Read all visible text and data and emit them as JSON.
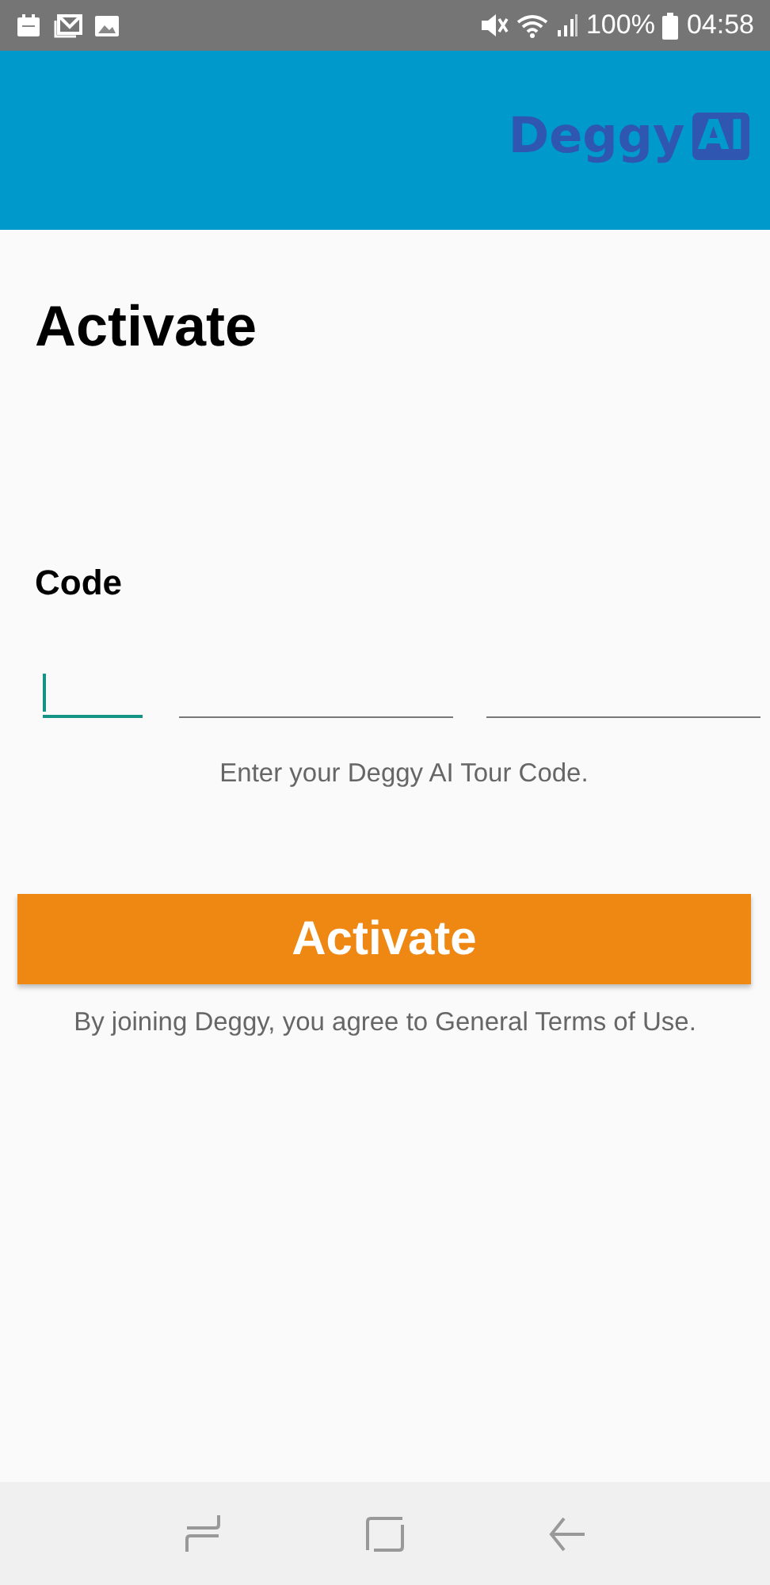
{
  "status_bar": {
    "battery": "100%",
    "time": "04:58"
  },
  "header": {
    "logo": {
      "name": "Deggy",
      "badge": "AI"
    }
  },
  "title": "Activate",
  "code": {
    "label": "Code",
    "fields": [
      {
        "focused": true
      },
      {
        "focused": false
      },
      {
        "focused": false
      }
    ],
    "hint": "Enter your Deggy AI Tour Code."
  },
  "activate_button": "Activate",
  "terms": "By joining Deggy, you agree to General Terms of Use."
}
